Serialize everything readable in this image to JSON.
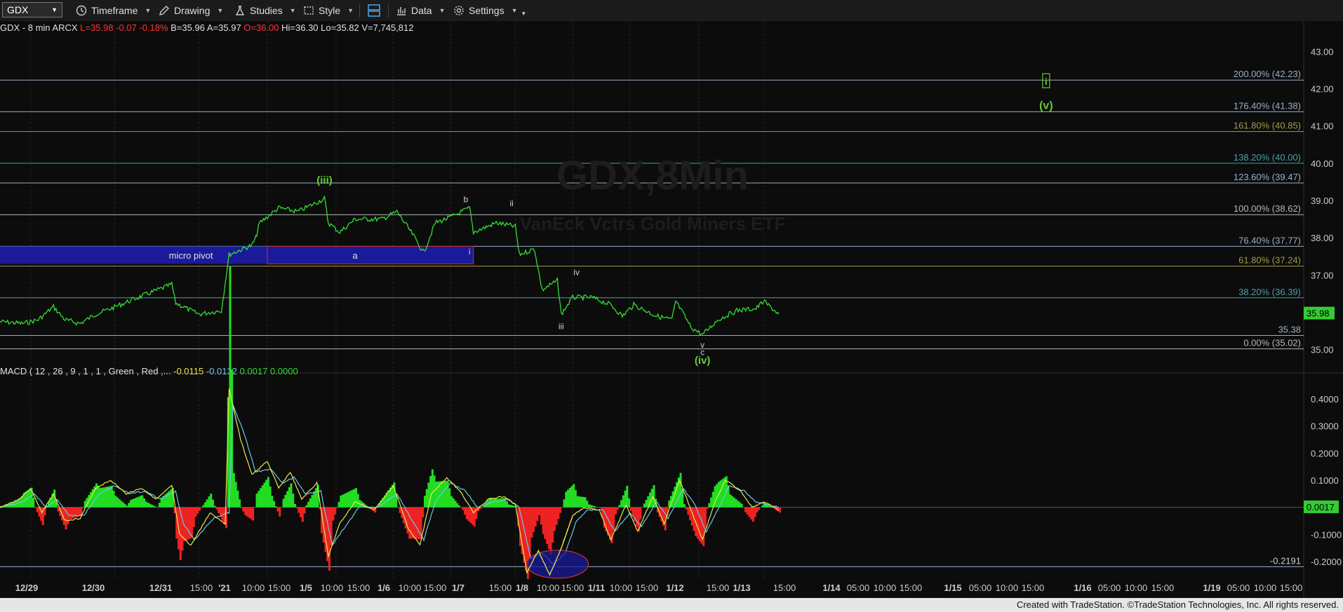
{
  "toolbar": {
    "symbol": "GDX",
    "timeframe_label": "Timeframe",
    "drawing_label": "Drawing",
    "studies_label": "Studies",
    "style_label": "Style",
    "data_label": "Data",
    "settings_label": "Settings",
    "icons": [
      "clock-icon",
      "pencil-icon",
      "flask-icon",
      "style-icon",
      "layout-icon",
      "bar-chart-icon",
      "gear-icon"
    ]
  },
  "header": {
    "symbol_line": "GDX - 8 min  ARCX",
    "L": "L=35.98",
    "chg": "-0.07",
    "pct": "-0.18%",
    "B": "B=35.96",
    "A": "A=35.97",
    "O": "O=36.00",
    "Hi": "Hi=36.30",
    "Lo": "Lo=35.82",
    "V": "V=7,745,812"
  },
  "footer": {
    "text": "Created with TradeStation. ©TradeStation Technologies, Inc. All rights reserved."
  },
  "chart_data": {
    "type": "line",
    "watermark": {
      "title": "GDX,8Min",
      "subtitle": "VanEck Vctrs Gold Miners ETF"
    },
    "price_axis": {
      "ylim": [
        34.6,
        43.4
      ],
      "ticks": [
        35.0,
        36.0,
        37.0,
        38.0,
        39.0,
        40.0,
        41.0,
        42.0,
        43.0
      ],
      "last_price": "35.98",
      "grid": false
    },
    "x_axis_labels": [
      "12/29",
      "12/30",
      "12/31",
      "15:00",
      "'21",
      "10:00",
      "15:00",
      "1/5",
      "10:00",
      "15:00",
      "1/6",
      "10:00",
      "15:00",
      "1/7",
      "15:00",
      "1/8",
      "10:00",
      "15:00",
      "1/11",
      "10:00",
      "15:00",
      "1/12",
      "15:00",
      "1/13",
      "15:00",
      "1/14",
      "05:00",
      "10:00",
      "15:00",
      "1/15",
      "05:00",
      "10:00",
      "15:00",
      "1/16",
      "05:00",
      "10:00",
      "15:00",
      "1/19",
      "05:00",
      "10:00",
      "15:00"
    ],
    "fib_levels": [
      {
        "label": "200.00% (42.23)",
        "value": 42.23,
        "color": "#9ab0c8"
      },
      {
        "label": "176.40% (41.38)",
        "value": 41.38,
        "color": "#9ab0c8"
      },
      {
        "label": "161.80% (40.85)",
        "value": 40.85,
        "color": "#a39a4a"
      },
      {
        "label": "138.20% (40.00)",
        "value": 40.0,
        "color": "#4aa0a6"
      },
      {
        "label": "123.60% (39.47)",
        "value": 39.47,
        "color": "#9ab0c8"
      },
      {
        "label": "100.00% (38.62)",
        "value": 38.62,
        "color": "#b8b8b8"
      },
      {
        "label": "76.40% (37.77)",
        "value": 37.77,
        "color": "#9ab0c8"
      },
      {
        "label": "61.80% (37.24)",
        "value": 37.24,
        "color": "#a39a4a"
      },
      {
        "label": "38.20% (36.39)",
        "value": 36.39,
        "color": "#4aa0a6"
      },
      {
        "label": "35.38",
        "value": 35.38,
        "color": "#9ab0c8"
      },
      {
        "label": "0.00% (35.02)",
        "value": 35.02,
        "color": "#b8b8b8"
      }
    ],
    "pivot_box": {
      "label": "micro pivot",
      "sublabel": "a",
      "low": 37.3,
      "high": 37.77
    },
    "wave_labels": [
      {
        "text": "(iii)",
        "bar": 85,
        "price": 39.45,
        "color": "#66cc33",
        "size": 15
      },
      {
        "text": "b",
        "bar": 122,
        "price": 38.95,
        "color": "#d0d0d0",
        "size": 12
      },
      {
        "text": "ii",
        "bar": 134,
        "price": 38.85,
        "color": "#d0d0d0",
        "size": 12
      },
      {
        "text": "i",
        "bar": 123,
        "price": 37.55,
        "color": "#d0d0d0",
        "size": 12
      },
      {
        "text": "iv",
        "bar": 151,
        "price": 37.0,
        "color": "#d0d0d0",
        "size": 12
      },
      {
        "text": "iii",
        "bar": 147,
        "price": 35.55,
        "color": "#d0d0d0",
        "size": 12
      },
      {
        "text": "v",
        "bar": 184,
        "price": 35.05,
        "color": "#d0d0d0",
        "size": 12
      },
      {
        "text": "c",
        "bar": 184,
        "price": 34.85,
        "color": "#d0d0d0",
        "size": 12
      },
      {
        "text": "(iv)",
        "bar": 184,
        "price": 34.62,
        "color": "#66cc33",
        "size": 15
      },
      {
        "text": "i",
        "bar": 274,
        "price": 42.1,
        "color": "#66cc33",
        "size": 14
      },
      {
        "text": "(v)",
        "bar": 274,
        "price": 41.45,
        "color": "#66cc33",
        "size": 16
      }
    ],
    "price_series": [
      {
        "bar": 0,
        "price": 35.75
      },
      {
        "bar": 6,
        "price": 35.7
      },
      {
        "bar": 10,
        "price": 35.8
      },
      {
        "bar": 14,
        "price": 36.15
      },
      {
        "bar": 17,
        "price": 35.8
      },
      {
        "bar": 21,
        "price": 35.7
      },
      {
        "bar": 25,
        "price": 35.95
      },
      {
        "bar": 29,
        "price": 36.1
      },
      {
        "bar": 35,
        "price": 36.35
      },
      {
        "bar": 40,
        "price": 36.55
      },
      {
        "bar": 45,
        "price": 36.75
      },
      {
        "bar": 46,
        "price": 36.25
      },
      {
        "bar": 52,
        "price": 35.95
      },
      {
        "bar": 58,
        "price": 36.05
      },
      {
        "bar": 60,
        "price": 37.55
      },
      {
        "bar": 66,
        "price": 37.8
      },
      {
        "bar": 67,
        "price": 38.0
      },
      {
        "bar": 68,
        "price": 38.4
      },
      {
        "bar": 73,
        "price": 38.8
      },
      {
        "bar": 78,
        "price": 38.7
      },
      {
        "bar": 85,
        "price": 39.05
      },
      {
        "bar": 86,
        "price": 38.4
      },
      {
        "bar": 89,
        "price": 38.15
      },
      {
        "bar": 93,
        "price": 38.5
      },
      {
        "bar": 100,
        "price": 38.5
      },
      {
        "bar": 104,
        "price": 38.7
      },
      {
        "bar": 108,
        "price": 38.1
      },
      {
        "bar": 111,
        "price": 37.6
      },
      {
        "bar": 114,
        "price": 38.4
      },
      {
        "bar": 118,
        "price": 38.55
      },
      {
        "bar": 123,
        "price": 38.8
      },
      {
        "bar": 124,
        "price": 38.15
      },
      {
        "bar": 130,
        "price": 38.4
      },
      {
        "bar": 135,
        "price": 38.3
      },
      {
        "bar": 136,
        "price": 37.55
      },
      {
        "bar": 140,
        "price": 37.7
      },
      {
        "bar": 142,
        "price": 36.6
      },
      {
        "bar": 146,
        "price": 36.85
      },
      {
        "bar": 147,
        "price": 35.95
      },
      {
        "bar": 150,
        "price": 36.4
      },
      {
        "bar": 155,
        "price": 36.4
      },
      {
        "bar": 160,
        "price": 36.2
      },
      {
        "bar": 163,
        "price": 35.9
      },
      {
        "bar": 166,
        "price": 36.2
      },
      {
        "bar": 172,
        "price": 35.9
      },
      {
        "bar": 176,
        "price": 35.8
      },
      {
        "bar": 177,
        "price": 36.3
      },
      {
        "bar": 181,
        "price": 35.6
      },
      {
        "bar": 184,
        "price": 35.4
      },
      {
        "bar": 188,
        "price": 35.8
      },
      {
        "bar": 193,
        "price": 36.05
      },
      {
        "bar": 198,
        "price": 36.1
      },
      {
        "bar": 200,
        "price": 36.3
      },
      {
        "bar": 204,
        "price": 35.95
      }
    ],
    "macd": {
      "label": "MACD ( 12 , 26 , 9 , 1 , 1 , Green , Red ,...",
      "values": [
        "-0.0115",
        "-0.0132",
        "0.0017",
        "0.0000"
      ],
      "value_colors": [
        "#e8e84a",
        "#6ac8e8",
        "#33dd33",
        "#33dd33"
      ],
      "ylim": [
        -0.27,
        0.47
      ],
      "ticks": [
        -0.2,
        -0.1,
        0.0,
        0.1,
        0.2,
        0.3,
        0.4
      ],
      "tick_labels": [
        "-0.2000",
        "-0.1000",
        "0.0000",
        "0.1000",
        "0.2000",
        "0.3000",
        "0.4000"
      ],
      "last_value": "0.0017",
      "ref_line": {
        "label": "-0.2191",
        "value": -0.2191
      },
      "highlight": {
        "bar_center": 146,
        "value_center": -0.21
      },
      "macd_series": [
        {
          "bar": 0,
          "value": 0.0
        },
        {
          "bar": 5,
          "value": 0.03
        },
        {
          "bar": 8,
          "value": 0.07
        },
        {
          "bar": 11,
          "value": -0.02
        },
        {
          "bar": 14,
          "value": 0.05
        },
        {
          "bar": 17,
          "value": -0.05
        },
        {
          "bar": 21,
          "value": -0.04
        },
        {
          "bar": 25,
          "value": 0.07
        },
        {
          "bar": 29,
          "value": 0.1
        },
        {
          "bar": 33,
          "value": 0.05
        },
        {
          "bar": 37,
          "value": 0.07
        },
        {
          "bar": 41,
          "value": 0.03
        },
        {
          "bar": 45,
          "value": 0.08
        },
        {
          "bar": 47,
          "value": -0.1
        },
        {
          "bar": 50,
          "value": -0.14
        },
        {
          "bar": 55,
          "value": -0.02
        },
        {
          "bar": 59,
          "value": -0.06
        },
        {
          "bar": 60,
          "value": 0.44
        },
        {
          "bar": 63,
          "value": 0.25
        },
        {
          "bar": 66,
          "value": 0.12
        },
        {
          "bar": 70,
          "value": 0.17
        },
        {
          "bar": 73,
          "value": 0.07
        },
        {
          "bar": 76,
          "value": 0.13
        },
        {
          "bar": 79,
          "value": 0.03
        },
        {
          "bar": 83,
          "value": 0.09
        },
        {
          "bar": 86,
          "value": -0.18
        },
        {
          "bar": 89,
          "value": -0.06
        },
        {
          "bar": 93,
          "value": 0.02
        },
        {
          "bar": 98,
          "value": -0.01
        },
        {
          "bar": 103,
          "value": 0.08
        },
        {
          "bar": 107,
          "value": -0.08
        },
        {
          "bar": 110,
          "value": -0.14
        },
        {
          "bar": 113,
          "value": 0.05
        },
        {
          "bar": 117,
          "value": 0.11
        },
        {
          "bar": 121,
          "value": 0.05
        },
        {
          "bar": 124,
          "value": -0.02
        },
        {
          "bar": 128,
          "value": 0.03
        },
        {
          "bar": 132,
          "value": 0.04
        },
        {
          "bar": 135,
          "value": 0.01
        },
        {
          "bar": 138,
          "value": -0.24
        },
        {
          "bar": 141,
          "value": -0.16
        },
        {
          "bar": 144,
          "value": -0.25
        },
        {
          "bar": 147,
          "value": -0.15
        },
        {
          "bar": 150,
          "value": -0.03
        },
        {
          "bar": 153,
          "value": 0.0
        },
        {
          "bar": 157,
          "value": -0.01
        },
        {
          "bar": 160,
          "value": -0.12
        },
        {
          "bar": 164,
          "value": 0.01
        },
        {
          "bar": 167,
          "value": -0.09
        },
        {
          "bar": 171,
          "value": 0.04
        },
        {
          "bar": 174,
          "value": -0.06
        },
        {
          "bar": 178,
          "value": 0.1
        },
        {
          "bar": 181,
          "value": -0.01
        },
        {
          "bar": 184,
          "value": -0.12
        },
        {
          "bar": 187,
          "value": 0.01
        },
        {
          "bar": 190,
          "value": 0.1
        },
        {
          "bar": 194,
          "value": 0.06
        },
        {
          "bar": 197,
          "value": 0.0
        },
        {
          "bar": 200,
          "value": 0.02
        },
        {
          "bar": 204,
          "value": -0.01
        }
      ],
      "signal_series": [
        {
          "bar": 0,
          "value": 0.0
        },
        {
          "bar": 6,
          "value": 0.02
        },
        {
          "bar": 9,
          "value": 0.05
        },
        {
          "bar": 12,
          "value": 0.0
        },
        {
          "bar": 15,
          "value": 0.03
        },
        {
          "bar": 18,
          "value": -0.03
        },
        {
          "bar": 22,
          "value": -0.03
        },
        {
          "bar": 26,
          "value": 0.05
        },
        {
          "bar": 30,
          "value": 0.08
        },
        {
          "bar": 34,
          "value": 0.05
        },
        {
          "bar": 38,
          "value": 0.06
        },
        {
          "bar": 42,
          "value": 0.03
        },
        {
          "bar": 46,
          "value": 0.06
        },
        {
          "bar": 48,
          "value": -0.06
        },
        {
          "bar": 51,
          "value": -0.12
        },
        {
          "bar": 56,
          "value": -0.04
        },
        {
          "bar": 60,
          "value": -0.02
        },
        {
          "bar": 61,
          "value": 0.38
        },
        {
          "bar": 64,
          "value": 0.27
        },
        {
          "bar": 67,
          "value": 0.13
        },
        {
          "bar": 71,
          "value": 0.14
        },
        {
          "bar": 74,
          "value": 0.09
        },
        {
          "bar": 77,
          "value": 0.11
        },
        {
          "bar": 80,
          "value": 0.05
        },
        {
          "bar": 84,
          "value": 0.06
        },
        {
          "bar": 87,
          "value": -0.14
        },
        {
          "bar": 90,
          "value": -0.08
        },
        {
          "bar": 94,
          "value": 0.0
        },
        {
          "bar": 99,
          "value": 0.0
        },
        {
          "bar": 104,
          "value": 0.05
        },
        {
          "bar": 108,
          "value": -0.05
        },
        {
          "bar": 111,
          "value": -0.12
        },
        {
          "bar": 114,
          "value": 0.02
        },
        {
          "bar": 118,
          "value": 0.09
        },
        {
          "bar": 122,
          "value": 0.06
        },
        {
          "bar": 125,
          "value": 0.0
        },
        {
          "bar": 129,
          "value": 0.02
        },
        {
          "bar": 133,
          "value": 0.03
        },
        {
          "bar": 136,
          "value": 0.0
        },
        {
          "bar": 139,
          "value": -0.19
        },
        {
          "bar": 142,
          "value": -0.17
        },
        {
          "bar": 145,
          "value": -0.21
        },
        {
          "bar": 148,
          "value": -0.17
        },
        {
          "bar": 151,
          "value": -0.05
        },
        {
          "bar": 154,
          "value": -0.01
        },
        {
          "bar": 158,
          "value": -0.01
        },
        {
          "bar": 161,
          "value": -0.09
        },
        {
          "bar": 165,
          "value": -0.02
        },
        {
          "bar": 168,
          "value": -0.07
        },
        {
          "bar": 172,
          "value": 0.02
        },
        {
          "bar": 175,
          "value": -0.04
        },
        {
          "bar": 179,
          "value": 0.07
        },
        {
          "bar": 182,
          "value": 0.01
        },
        {
          "bar": 185,
          "value": -0.09
        },
        {
          "bar": 188,
          "value": -0.01
        },
        {
          "bar": 191,
          "value": 0.08
        },
        {
          "bar": 195,
          "value": 0.06
        },
        {
          "bar": 198,
          "value": 0.02
        },
        {
          "bar": 201,
          "value": 0.01
        },
        {
          "bar": 204,
          "value": 0.0
        }
      ]
    }
  },
  "colors": {
    "background": "#0c0c0c",
    "price_line": "#33dd33",
    "macd_line": "#e8e84a",
    "signal_line": "#6ac8e8",
    "hist_up": "#22dd22",
    "hist_down": "#ee2222",
    "pivot_fill": "#1a1a9a",
    "pivot_border": "#cc3333",
    "axis_text": "#cccccc",
    "down": "#ff3333"
  }
}
